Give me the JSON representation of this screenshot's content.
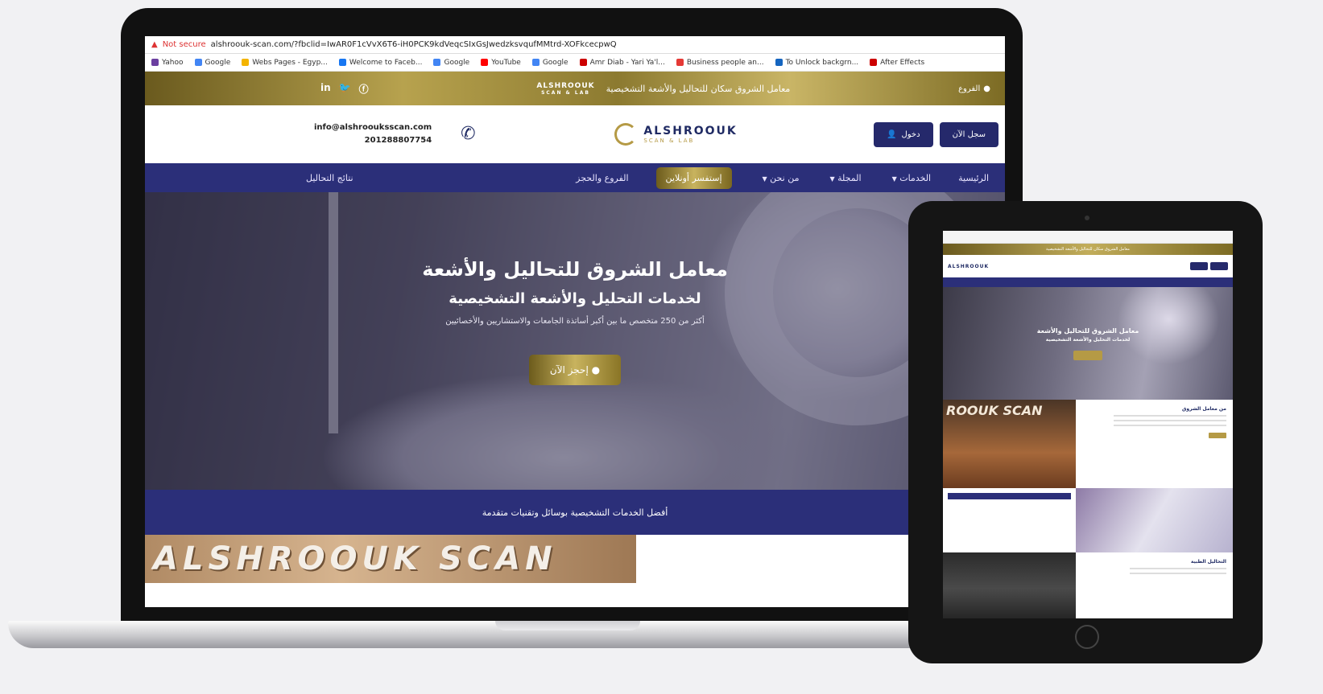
{
  "browser": {
    "security": "Not secure",
    "url": "alshroouk-scan.com/?fbclid=IwAR0F1cVvX6T6-iH0PCK9kdVeqcSIxGsJwedzksvqufMMtrd-XOFkcecpwQ",
    "bookmarks": [
      "Yahoo",
      "Google",
      "Webs Pages - Egyp...",
      "Welcome to Faceb...",
      "Google",
      "YouTube",
      "Google",
      "Amr Diab - Yari Ya'l...",
      "Business people an...",
      "To Unlock backgrn...",
      "After Effects"
    ]
  },
  "topbar": {
    "branches": "الفروع",
    "tagline": "معامل الشروق سكان للتحاليل والأشعة التشخيصية",
    "logo_name": "ALSHROOUK",
    "logo_sub": "SCAN & LAB",
    "social": [
      "in",
      "tw",
      "fb"
    ]
  },
  "header": {
    "email": "info@alshroouksscan.com",
    "phone": "201288807754",
    "brand_name": "ALSHROOUK",
    "brand_sub": "SCAN & LAB",
    "login_label": "دخول",
    "register_label": "سجل الآن"
  },
  "nav": {
    "items": [
      {
        "label": "الرئيسية",
        "has_menu": false
      },
      {
        "label": "الخدمات",
        "has_menu": true
      },
      {
        "label": "المجلة",
        "has_menu": true
      },
      {
        "label": "من نحن",
        "has_menu": true
      }
    ],
    "cta": "إستفسر أونلاين",
    "branches": "الفروع والحجز",
    "results": "نتائج التحاليل",
    "chevron_icon": "chevron-down-icon"
  },
  "hero": {
    "title": "معامل الشروق للتحاليل والأشعة",
    "subtitle": "لخدمات التحليل والأشعة التشخيصية",
    "description": "أكثر من 250 متخصص ما بين أكبر أساتذة الجامعات والاستشاريين والأخصائيين",
    "cta": "إحجز الآن"
  },
  "strip": {
    "text": "أفضل الخدمات التشخيصية بوسائل وتقنيات متقدمة"
  },
  "scan_sign": "ALSHROOUK SCAN",
  "tablet": {
    "hero_title": "معامل الشروق للتحاليل والأشعة",
    "hero_sub": "لخدمات التحليل والأشعة التشخيصية",
    "brand": "ALSHROOUK",
    "scan_sign": "ROOUK SCAN",
    "card1_title": "من معامل الشروق",
    "card2_title": "التحاليل الطبية"
  },
  "colors": {
    "navy": "#2b2f79",
    "gold": "#b59a45"
  }
}
